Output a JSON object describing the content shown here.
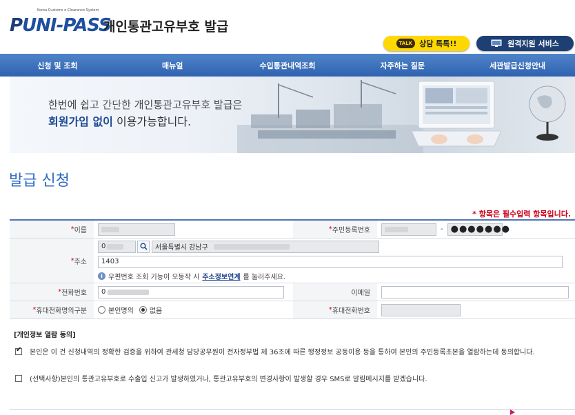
{
  "header": {
    "logo_tagline": "Korea Customs e-Clearance System",
    "logo_text": "UNI-PASS",
    "logo_initial": "P",
    "site_title": "개인통관고유부호 발급",
    "talk_button": {
      "icon": "TALK",
      "label": "상담 톡톡!!"
    },
    "remote_button": {
      "icon": "monitor-icon",
      "label": "원격지원 서비스"
    }
  },
  "nav": {
    "items": [
      "신청 및 조회",
      "매뉴얼",
      "수입통관내역조회",
      "자주하는 질문",
      "세관발급신청안내"
    ]
  },
  "banner": {
    "line1_prefix": "한번에 쉽고 ",
    "line1_highlight": "간단한",
    "line1_suffix": " 개인통관고유부호 발급은",
    "line2_bold": "회원가입 없이",
    "line2_suffix": " 이용가능합니다."
  },
  "page": {
    "title": "발급 신청",
    "required_note": "* 항목은 필수입력 항목입니다."
  },
  "form": {
    "name_label": "이름",
    "rrn_label": "주민등록번호",
    "rrn_separator": "-",
    "rrn_back": "●●●●●●●",
    "address_label": "주소",
    "postal_prefix": "0",
    "address_city": "서울특별시 강남구",
    "address_detail": "1403",
    "address_note_prefix": "우편번호 조회 기능이 오동작 시 ",
    "address_note_link": "주소정보연계",
    "address_note_suffix": "를 눌러주세요.",
    "phone_label": "전화번호",
    "phone_prefix": "0",
    "email_label": "이메일",
    "mobile_type_label": "휴대전화명의구분",
    "mobile_type_options": [
      "본인명의",
      "없음"
    ],
    "mobile_type_selected": "없음",
    "mobile_label": "휴대전화번호"
  },
  "consent": {
    "title": "[개인정보 열람 동의]",
    "items": [
      {
        "checked": true,
        "text": "본인은 이 건 신청내역의 정확한 검증을 위하여 관세청 담당공무원이 전자정부법 제 36조에 따른 행정정보 공동이용 등을 통하여 본인의 주민등록초본을 열람하는데 동의합니다."
      },
      {
        "checked": false,
        "text": "(선택사항)본인의 통관고유부호로 수출입 신고가 발생하였거나, 통관고유부호의 변경사항이 발생할 경우 SMS로 알림메시지를 받겠습니다."
      }
    ]
  },
  "colors": {
    "nav": "#2f63b0",
    "title": "#2d6bc3",
    "required": "#d0021b",
    "talk": "#ffd800",
    "remote": "#1d3f73"
  }
}
